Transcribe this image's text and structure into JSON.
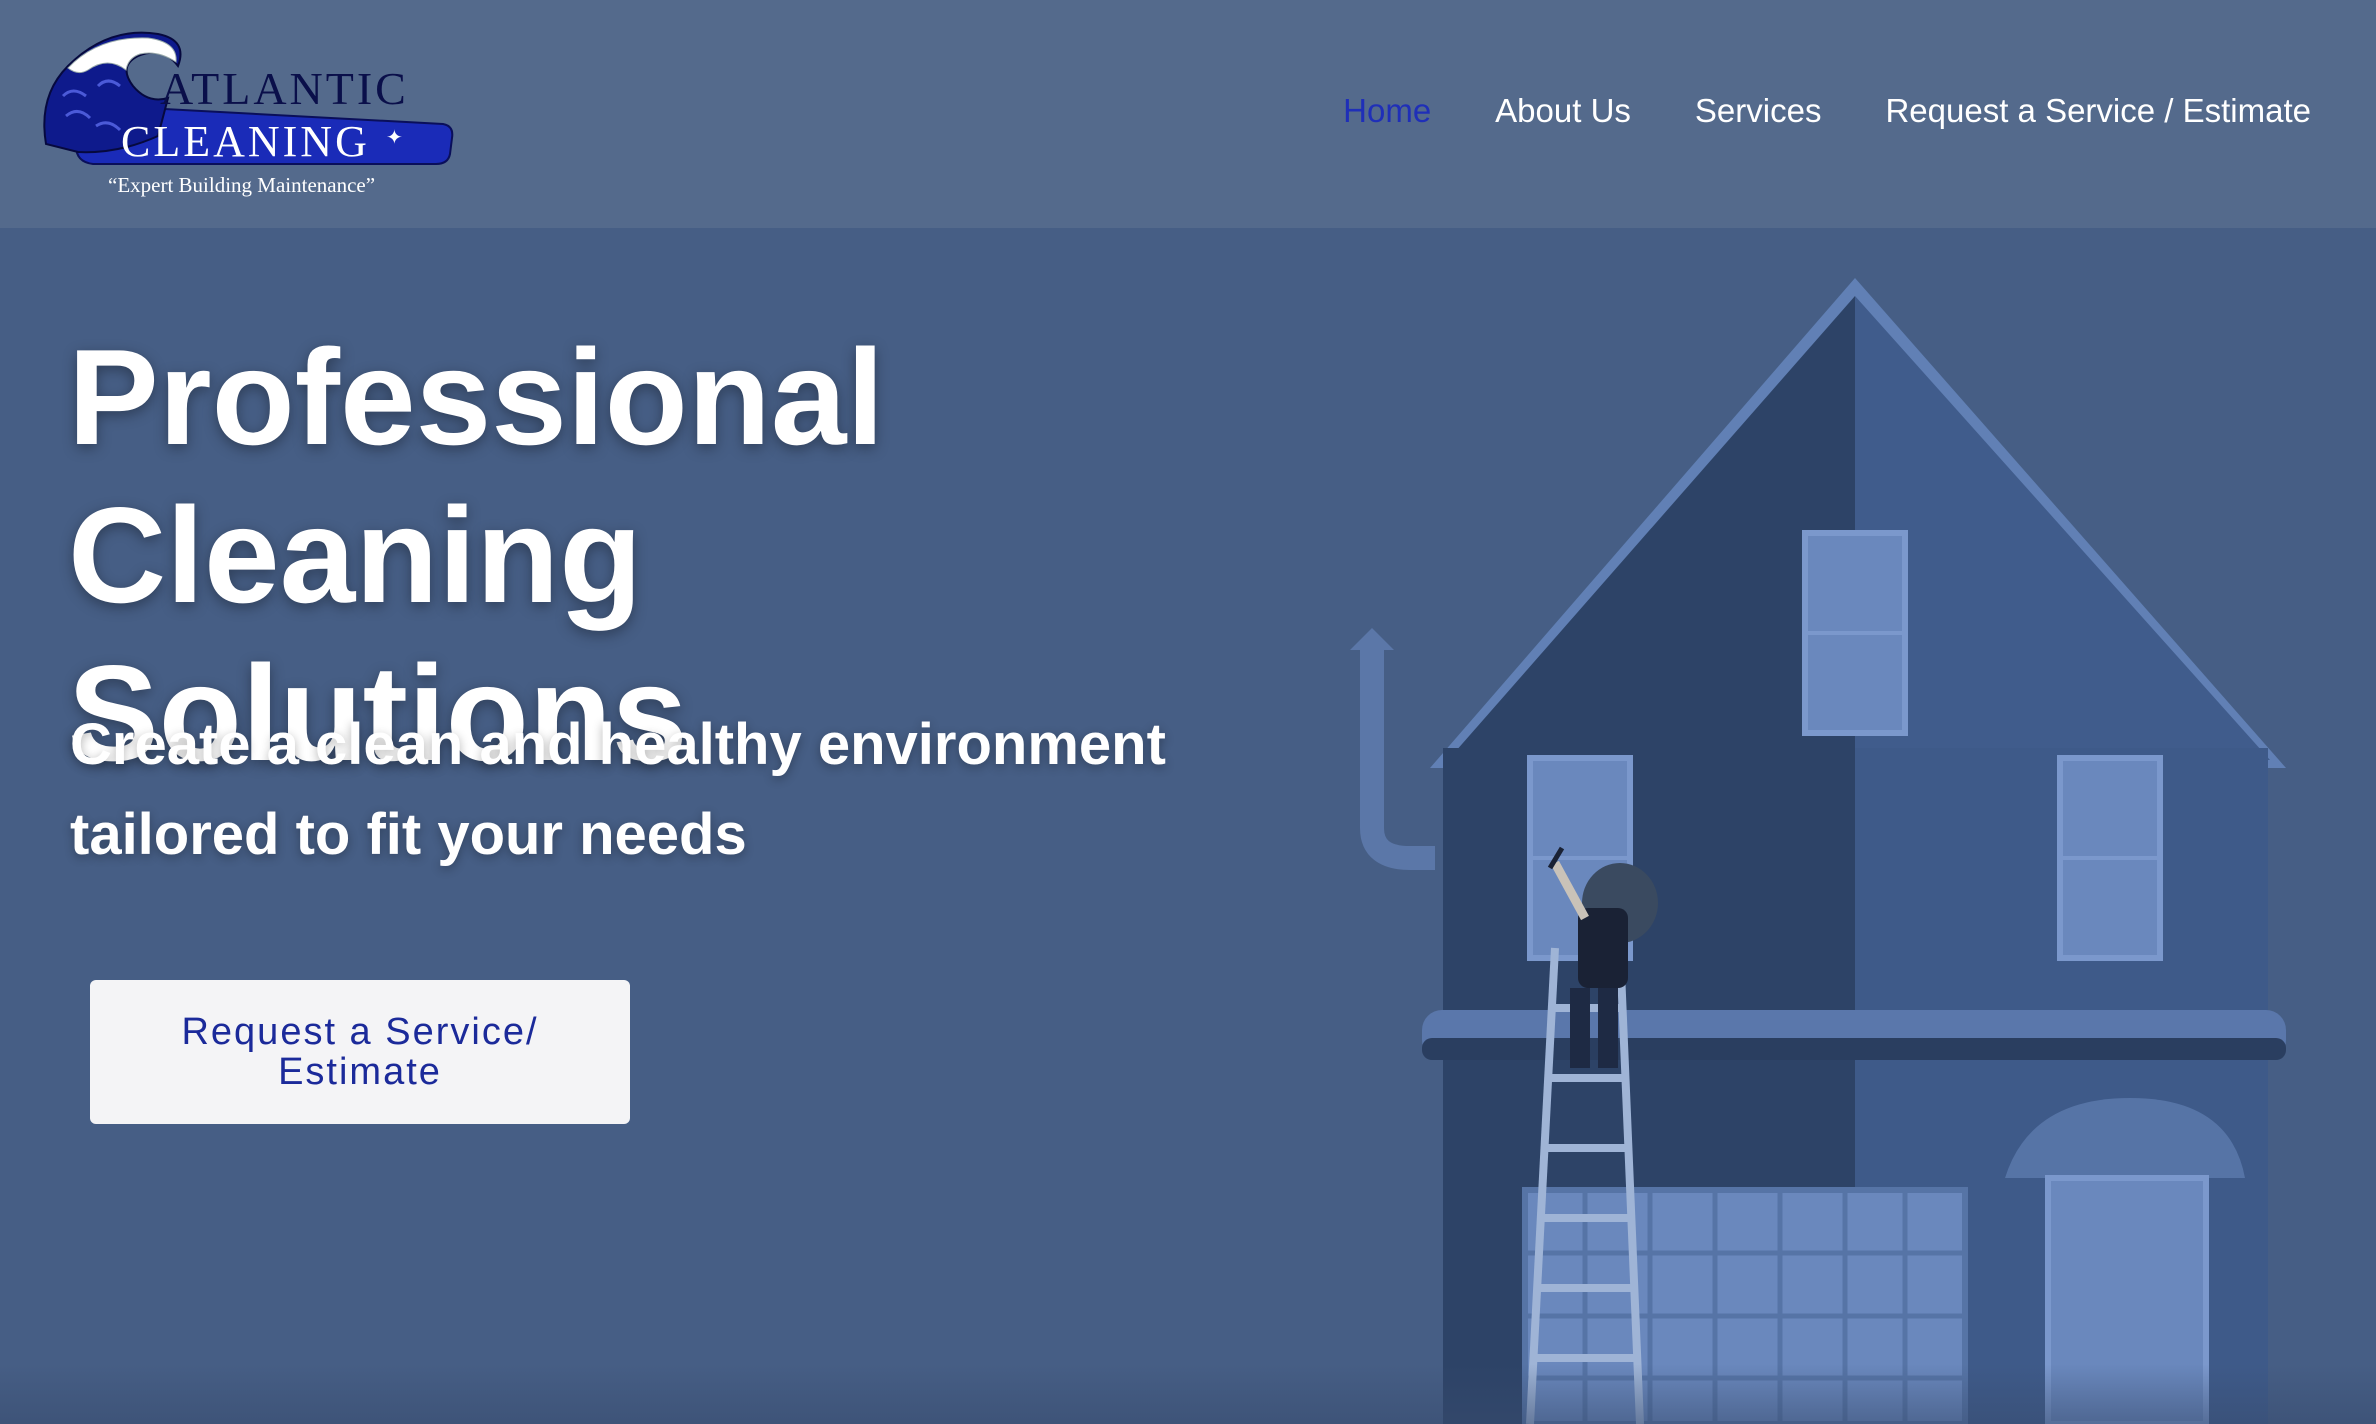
{
  "header": {
    "logo": {
      "line1": "ATLANTIC",
      "line2": "CLEANING",
      "tagline": "“Expert Building Maintenance”"
    },
    "nav": [
      {
        "label": "Home",
        "active": true
      },
      {
        "label": "About Us",
        "active": false
      },
      {
        "label": "Services",
        "active": false
      },
      {
        "label": "Request a Service / Estimate",
        "active": false
      }
    ]
  },
  "hero": {
    "headline_line1": "Professional",
    "headline_line2": "Cleaning Solutions",
    "subheadline": "Create a clean and healthy environment tailored to fit your needs",
    "cta_label": "Request a Service/ Estimate"
  },
  "colors": {
    "header_bg": "#546a8c",
    "hero_bg": "#465e85",
    "nav_active": "#1f2fb8",
    "cta_bg": "#f4f4f6",
    "cta_text": "#1b2a9a"
  },
  "icons": [
    "wave-logo-icon",
    "sparkle-icon",
    "house-illustration",
    "window-washer-illustration"
  ]
}
